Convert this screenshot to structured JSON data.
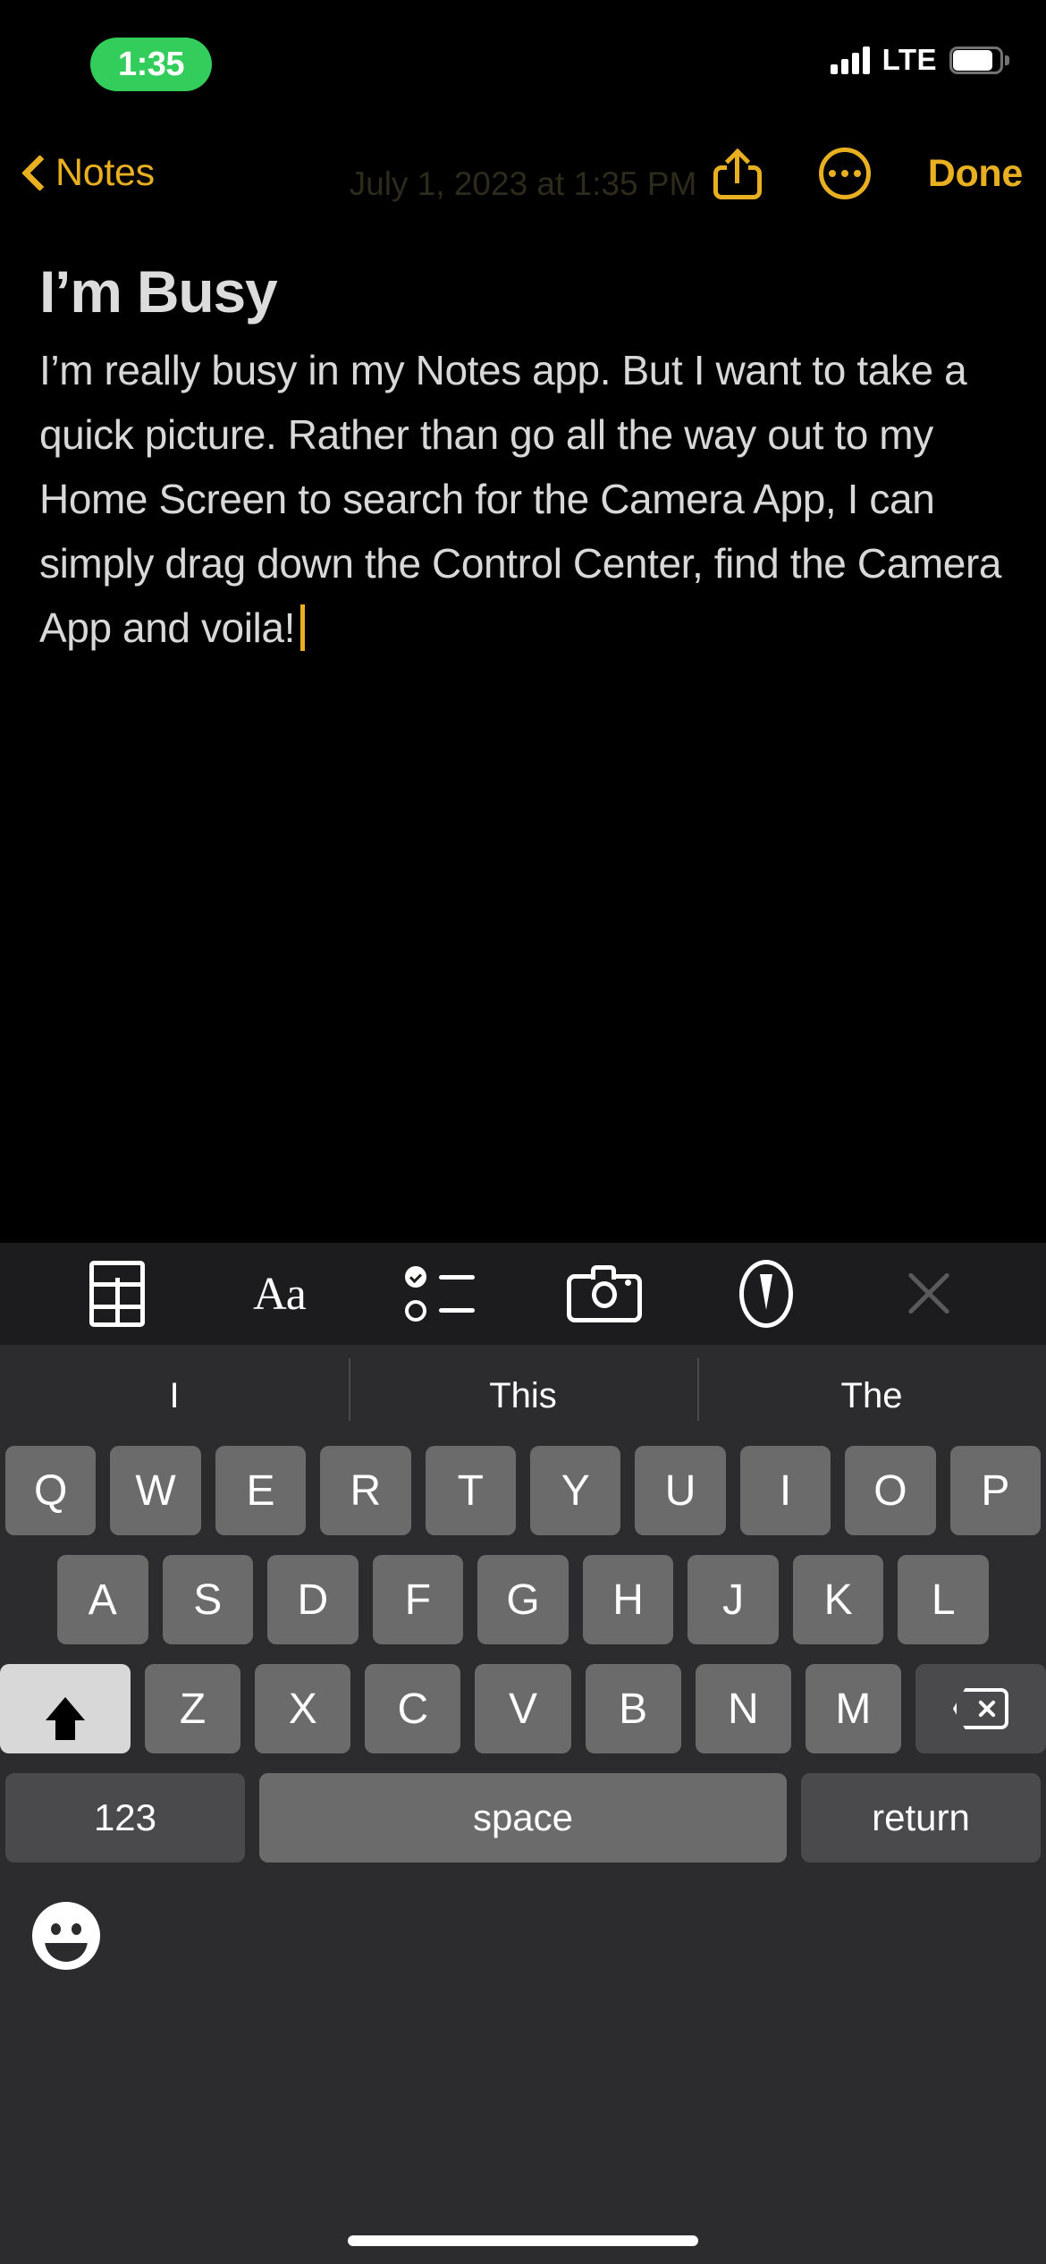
{
  "app": {
    "name": "Notes",
    "accent_color": "#e8b020",
    "background_color": "#000000",
    "keyboard_background": "#2c2c2e"
  },
  "status_bar": {
    "time": "1:35",
    "time_pill_color": "#32cd5a",
    "carrier_network": "LTE",
    "signal_bars": 4,
    "battery_icon": "battery-icon",
    "battery_level_percent": 85
  },
  "nav_bar": {
    "back_label": "Notes",
    "back_icon": "chevron-left-icon",
    "date_label": "July 1, 2023 at 1:35 PM",
    "share_icon": "share-icon",
    "more_icon": "more-circle-icon",
    "done_label": "Done"
  },
  "note": {
    "title": "I’m Busy",
    "body": "I’m really busy in my Notes app. But I want to take a quick picture. Rather than go all the way out to my Home Screen to search for the Camera App, I can simply drag down the Control Center, find the Camera App and voila!",
    "caret_color": "#e8b020"
  },
  "format_toolbar": {
    "items": [
      {
        "name": "table-icon",
        "label": "Table"
      },
      {
        "name": "text-format-icon",
        "label": "Aa"
      },
      {
        "name": "checklist-icon",
        "label": "Checklist"
      },
      {
        "name": "camera-icon",
        "label": "Camera"
      },
      {
        "name": "markup-pen-icon",
        "label": "Markup"
      },
      {
        "name": "close-icon",
        "label": "Close"
      }
    ]
  },
  "keyboard": {
    "predictions": [
      "I",
      "This",
      "The"
    ],
    "row1": [
      "Q",
      "W",
      "E",
      "R",
      "T",
      "Y",
      "U",
      "I",
      "O",
      "P"
    ],
    "row2": [
      "A",
      "S",
      "D",
      "F",
      "G",
      "H",
      "J",
      "K",
      "L"
    ],
    "row3": [
      "Z",
      "X",
      "C",
      "V",
      "B",
      "N",
      "M"
    ],
    "shift_icon": "shift-up-arrow-icon",
    "shift_active": true,
    "delete_icon": "delete-backward-icon",
    "numbers_label": "123",
    "space_label": "space",
    "return_label": "return",
    "emoji_icon": "smiley-face-icon"
  }
}
